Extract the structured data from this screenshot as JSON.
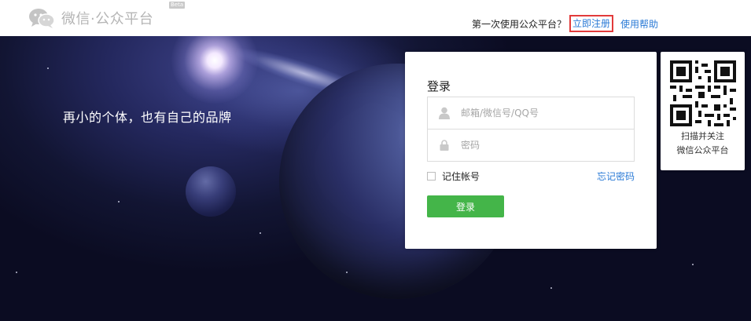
{
  "header": {
    "logo_text": "微信·公众平台",
    "beta_badge": "Beta",
    "first_time_text": "第一次使用公众平台？",
    "register_link": "立即注册",
    "help_link": "使用帮助"
  },
  "banner": {
    "slogan": "再小的个体，也有自己的品牌"
  },
  "login": {
    "title": "登录",
    "username_placeholder": "邮箱/微信号/QQ号",
    "password_placeholder": "密码",
    "remember_label": "记住帐号",
    "forgot_link": "忘记密码",
    "submit_label": "登录"
  },
  "qr": {
    "line1": "扫描并关注",
    "line2": "微信公众平台"
  },
  "colors": {
    "link": "#2a7ad6",
    "button": "#44b549",
    "highlight_border": "#e23b3b"
  }
}
